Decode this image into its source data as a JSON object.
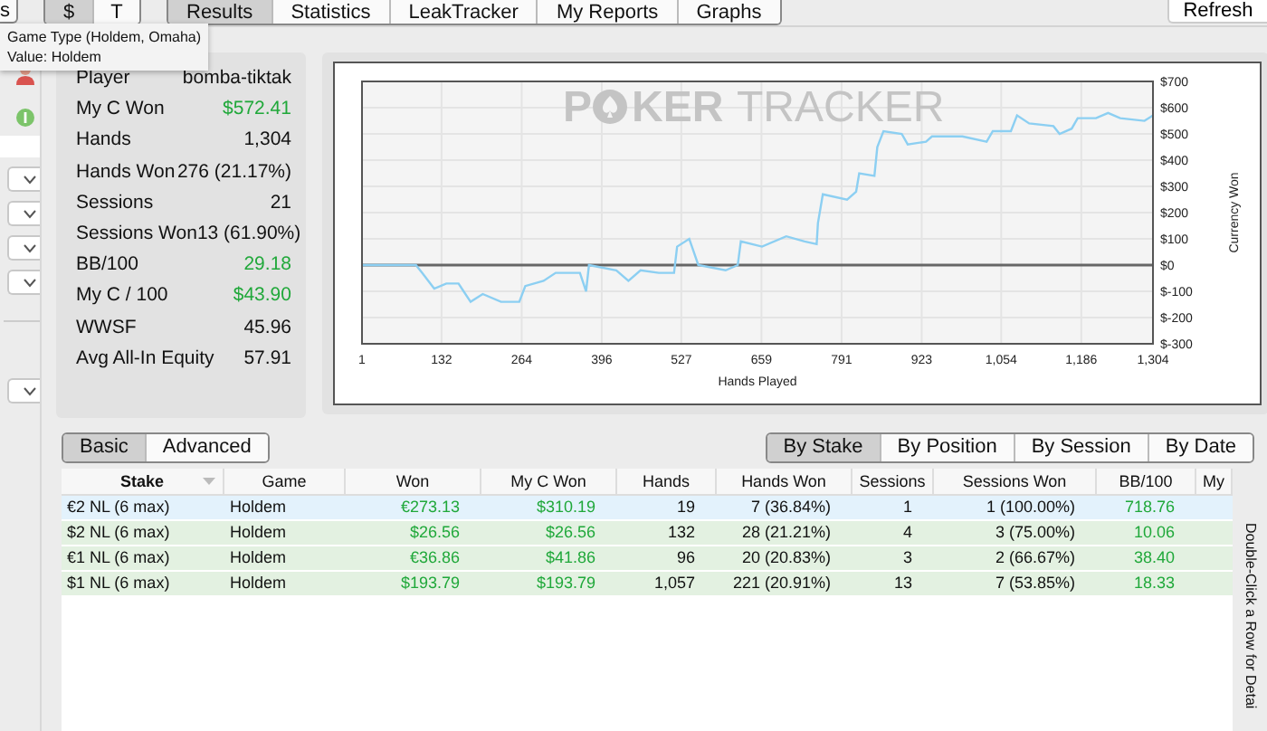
{
  "toolbar": {
    "edge_button": "s",
    "currency_toggle": [
      {
        "label": "$",
        "selected": true
      },
      {
        "label": "T",
        "selected": false
      }
    ],
    "tabs": [
      {
        "label": "Results",
        "selected": true
      },
      {
        "label": "Statistics",
        "selected": false
      },
      {
        "label": "LeakTracker",
        "selected": false
      },
      {
        "label": "My Reports",
        "selected": false
      },
      {
        "label": "Graphs",
        "selected": false
      }
    ],
    "refresh": "Refresh"
  },
  "tooltip": [
    "Game Type (Holdem, Omaha)",
    "Value: Holdem"
  ],
  "sidebar": [
    {
      "kind": "person"
    },
    {
      "kind": "status"
    },
    {
      "kind": "field"
    },
    {
      "kind": "dropdown"
    },
    {
      "kind": "dropdown"
    },
    {
      "kind": "dropdown"
    },
    {
      "kind": "dropdown"
    },
    {
      "kind": "divider"
    },
    {
      "kind": "dropdown"
    }
  ],
  "stats": [
    {
      "label": "Player",
      "value": "bomba-tiktak",
      "positive": false
    },
    {
      "label": "My C Won",
      "value": "$572.41",
      "positive": true
    },
    {
      "label": "Hands",
      "value": "1,304",
      "positive": false
    },
    {
      "label": "Hands Won",
      "value": "276 (21.17%)",
      "positive": false
    },
    {
      "label": "Sessions",
      "value": "21",
      "positive": false
    },
    {
      "label": "Sessions Won",
      "value": "13 (61.90%)",
      "positive": false
    },
    {
      "label": "BB/100",
      "value": "29.18",
      "positive": true
    },
    {
      "label": "My C / 100",
      "value": "$43.90",
      "positive": true
    },
    {
      "label": "WWSF",
      "value": "45.96",
      "positive": false
    },
    {
      "label": "Avg All-In Equity",
      "value": "57.91",
      "positive": false
    }
  ],
  "graph": {
    "logo": [
      "P",
      "KER",
      "TRACKER"
    ],
    "chart_data": {
      "type": "line",
      "grid": true,
      "xlabel": "Hands Played",
      "ylabel": "Currency Won",
      "x": [
        1,
        90,
        100,
        120,
        140,
        160,
        180,
        200,
        230,
        260,
        270,
        300,
        320,
        360,
        370,
        375,
        420,
        440,
        460,
        490,
        515,
        520,
        540,
        555,
        600,
        620,
        625,
        660,
        700,
        730,
        750,
        752,
        760,
        800,
        815,
        820,
        845,
        850,
        860,
        890,
        900,
        930,
        940,
        990,
        1030,
        1040,
        1070,
        1080,
        1100,
        1140,
        1150,
        1170,
        1180,
        1210,
        1230,
        1250,
        1290,
        1304
      ],
      "series": [
        {
          "color": "#8ccff2",
          "values": [
            0,
            0,
            -30,
            -90,
            -70,
            -70,
            -140,
            -110,
            -140,
            -140,
            -80,
            -60,
            -30,
            -30,
            -100,
            0,
            -20,
            -60,
            -20,
            -30,
            -30,
            70,
            100,
            0,
            -20,
            0,
            90,
            70,
            110,
            90,
            80,
            160,
            270,
            250,
            280,
            350,
            340,
            450,
            510,
            500,
            460,
            470,
            490,
            490,
            470,
            510,
            510,
            570,
            540,
            530,
            500,
            520,
            560,
            560,
            580,
            560,
            550,
            570
          ]
        }
      ],
      "xlim": [
        1,
        1304
      ],
      "ylim": [
        -300,
        700
      ],
      "xticks": [
        {
          "value": 1,
          "label": "1"
        },
        {
          "value": 132,
          "label": "132"
        },
        {
          "value": 264,
          "label": "264"
        },
        {
          "value": 396,
          "label": "396"
        },
        {
          "value": 527,
          "label": "527"
        },
        {
          "value": 659,
          "label": "659"
        },
        {
          "value": 791,
          "label": "791"
        },
        {
          "value": 923,
          "label": "923"
        },
        {
          "value": 1054,
          "label": "1,054"
        },
        {
          "value": 1186,
          "label": "1,186"
        },
        {
          "value": 1304,
          "label": "1,304"
        }
      ],
      "yticks": [
        {
          "value": 700,
          "label": "$700"
        },
        {
          "value": 600,
          "label": "$600"
        },
        {
          "value": 500,
          "label": "$500"
        },
        {
          "value": 400,
          "label": "$400"
        },
        {
          "value": 300,
          "label": "$300"
        },
        {
          "value": 200,
          "label": "$200"
        },
        {
          "value": 100,
          "label": "$100"
        },
        {
          "value": 0,
          "label": "$0"
        },
        {
          "value": -100,
          "label": "$-100"
        },
        {
          "value": -200,
          "label": "$-200"
        },
        {
          "value": -300,
          "label": "$-300"
        }
      ]
    }
  },
  "view_toggle": [
    {
      "label": "Basic",
      "selected": true
    },
    {
      "label": "Advanced",
      "selected": false
    }
  ],
  "group_toggle": [
    {
      "label": "By Stake",
      "selected": true
    },
    {
      "label": "By Position",
      "selected": false
    },
    {
      "label": "By Session",
      "selected": false
    },
    {
      "label": "By Date",
      "selected": false
    }
  ],
  "table": {
    "columns": [
      "Stake",
      "Game",
      "Won",
      "My C Won",
      "Hands",
      "Hands Won",
      "Sessions",
      "Sessions Won",
      "BB/100",
      "My"
    ],
    "rows": [
      {
        "selected": true,
        "cells": [
          "€2 NL (6 max)",
          "Holdem",
          "€273.13",
          "$310.19",
          "19",
          "7 (36.84%)",
          "1",
          "1 (100.00%)",
          "718.76"
        ]
      },
      {
        "selected": false,
        "cells": [
          "$2 NL (6 max)",
          "Holdem",
          "$26.56",
          "$26.56",
          "132",
          "28 (21.21%)",
          "4",
          "3 (75.00%)",
          "10.06"
        ]
      },
      {
        "selected": false,
        "cells": [
          "€1 NL (6 max)",
          "Holdem",
          "€36.86",
          "$41.86",
          "96",
          "20 (20.83%)",
          "3",
          "2 (66.67%)",
          "38.40"
        ]
      },
      {
        "selected": false,
        "cells": [
          "$1 NL (6 max)",
          "Holdem",
          "$193.79",
          "$193.79",
          "1,057",
          "221 (20.91%)",
          "13",
          "7 (53.85%)",
          "18.33"
        ]
      }
    ]
  },
  "side_hint": "Double-Click a Row for Detai"
}
